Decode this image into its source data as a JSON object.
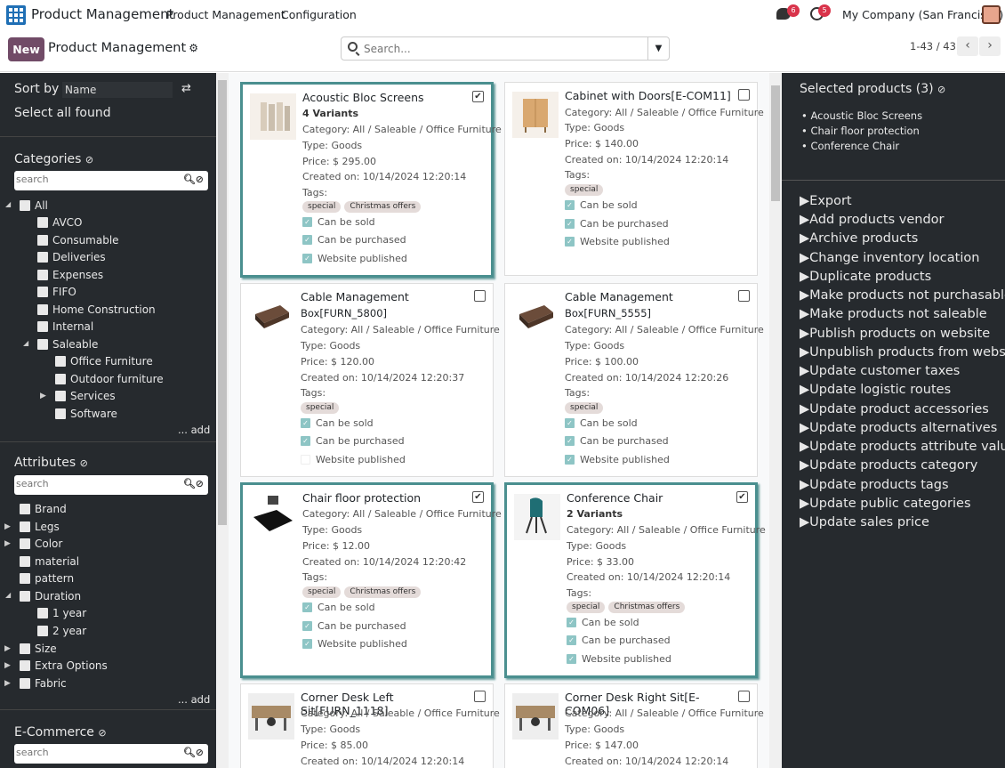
{
  "app": {
    "title": "Product Management"
  },
  "nav": {
    "menu_product": "Product Management",
    "menu_config": "Configuration"
  },
  "systray": {
    "messages_count": "6",
    "activities_count": "5",
    "company": "My Company (San Francisco)"
  },
  "control": {
    "new_label": "New",
    "page_title": "Product Management",
    "search_placeholder": "Search...",
    "pager": "1-43 / 43"
  },
  "left": {
    "sort_by_label": "Sort by",
    "sort_value": "Name",
    "select_all": "Select all found",
    "categories_title": "Categories",
    "search_placeholder": "search",
    "categories": [
      "All",
      "AVCO",
      "Consumable",
      "Deliveries",
      "Expenses",
      "FIFO",
      "Home Construction",
      "Internal",
      "Saleable",
      "Office Furniture",
      "Outdoor furniture",
      "Services",
      "Software"
    ],
    "add_label": "... add",
    "attributes_title": "Attributes",
    "attributes": [
      "Brand",
      "Legs",
      "Color",
      "material",
      "pattern",
      "Duration",
      "1 year",
      "2 year",
      "Size",
      "Extra Options",
      "Fabric"
    ],
    "ecommerce_title": "E-Commerce"
  },
  "cards": [
    {
      "name": "Acoustic Bloc Screens",
      "variants": "4 Variants",
      "category": "Category: All / Saleable / Office Furniture",
      "type": "Type: Goods",
      "price": "Price: $ 295.00",
      "created": "Created on: 10/14/2024 12:20:14",
      "tags_label": "Tags:",
      "tags": [
        "special",
        "Christmas offers"
      ],
      "sold": "Can be sold",
      "purchased": "Can be purchased",
      "published": "Website published"
    },
    {
      "name": "Cabinet with Doors[E-COM11]",
      "category": "Category: All / Saleable / Office Furniture",
      "type": "Type: Goods",
      "price": "Price: $ 140.00",
      "created": "Created on: 10/14/2024 12:20:14",
      "tags_label": "Tags:",
      "tags": [
        "special"
      ],
      "sold": "Can be sold",
      "purchased": "Can be purchased",
      "published": "Website published"
    },
    {
      "name_line1": "Cable Management",
      "name_line2": "Box[FURN_5800]",
      "category": "Category: All / Saleable / Office Furniture",
      "type": "Type: Goods",
      "price": "Price: $ 120.00",
      "created": "Created on: 10/14/2024 12:20:37",
      "tags_label": "Tags:",
      "tags": [
        "special"
      ],
      "sold": "Can be sold",
      "purchased": "Can be purchased",
      "published": "Website published"
    },
    {
      "name_line1": "Cable Management",
      "name_line2": "Box[FURN_5555]",
      "category": "Category: All / Saleable / Office Furniture",
      "type": "Type: Goods",
      "price": "Price: $ 100.00",
      "created": "Created on: 10/14/2024 12:20:26",
      "tags_label": "Tags:",
      "tags": [
        "special"
      ],
      "sold": "Can be sold",
      "purchased": "Can be purchased",
      "published": "Website published"
    },
    {
      "name": "Chair floor protection",
      "category": "Category: All / Saleable / Office Furniture",
      "type": "Type: Goods",
      "price": "Price: $ 12.00",
      "created": "Created on: 10/14/2024 12:20:42",
      "tags_label": "Tags:",
      "tags": [
        "special",
        "Christmas offers"
      ],
      "sold": "Can be sold",
      "purchased": "Can be purchased",
      "published": "Website published"
    },
    {
      "name": "Conference Chair",
      "variants": "2 Variants",
      "category": "Category: All / Saleable / Office Furniture",
      "type": "Type: Goods",
      "price": "Price: $ 33.00",
      "created": "Created on: 10/14/2024 12:20:14",
      "tags_label": "Tags:",
      "tags": [
        "special",
        "Christmas offers"
      ],
      "sold": "Can be sold",
      "purchased": "Can be purchased",
      "published": "Website published"
    },
    {
      "name": "Corner Desk Left Sit[FURN_1118]",
      "category": "Category: All / Saleable / Office Furniture",
      "type": "Type: Goods",
      "price": "Price: $ 85.00",
      "created": "Created on: 10/14/2024 12:20:14"
    },
    {
      "name": "Corner Desk Right Sit[E-COM06]",
      "category": "Category: All / Saleable / Office Furniture",
      "type": "Type: Goods",
      "price": "Price: $ 147.00",
      "created": "Created on: 10/14/2024 12:20:14"
    }
  ],
  "right": {
    "title": "Selected products (3)",
    "selected": [
      "Acoustic Bloc Screens",
      "Chair floor protection",
      "Conference Chair"
    ],
    "actions": [
      "Export",
      "Add products vendor",
      "Archive products",
      "Change inventory location",
      "Duplicate products",
      "Make products not purchasable",
      "Make products not saleable",
      "Publish products on website",
      "Unpublish products from website",
      "Update customer taxes",
      "Update logistic routes",
      "Update product accessories",
      "Update products alternatives",
      "Update products attribute values",
      "Update products category",
      "Update products tags",
      "Update public categories",
      "Update sales price"
    ]
  }
}
